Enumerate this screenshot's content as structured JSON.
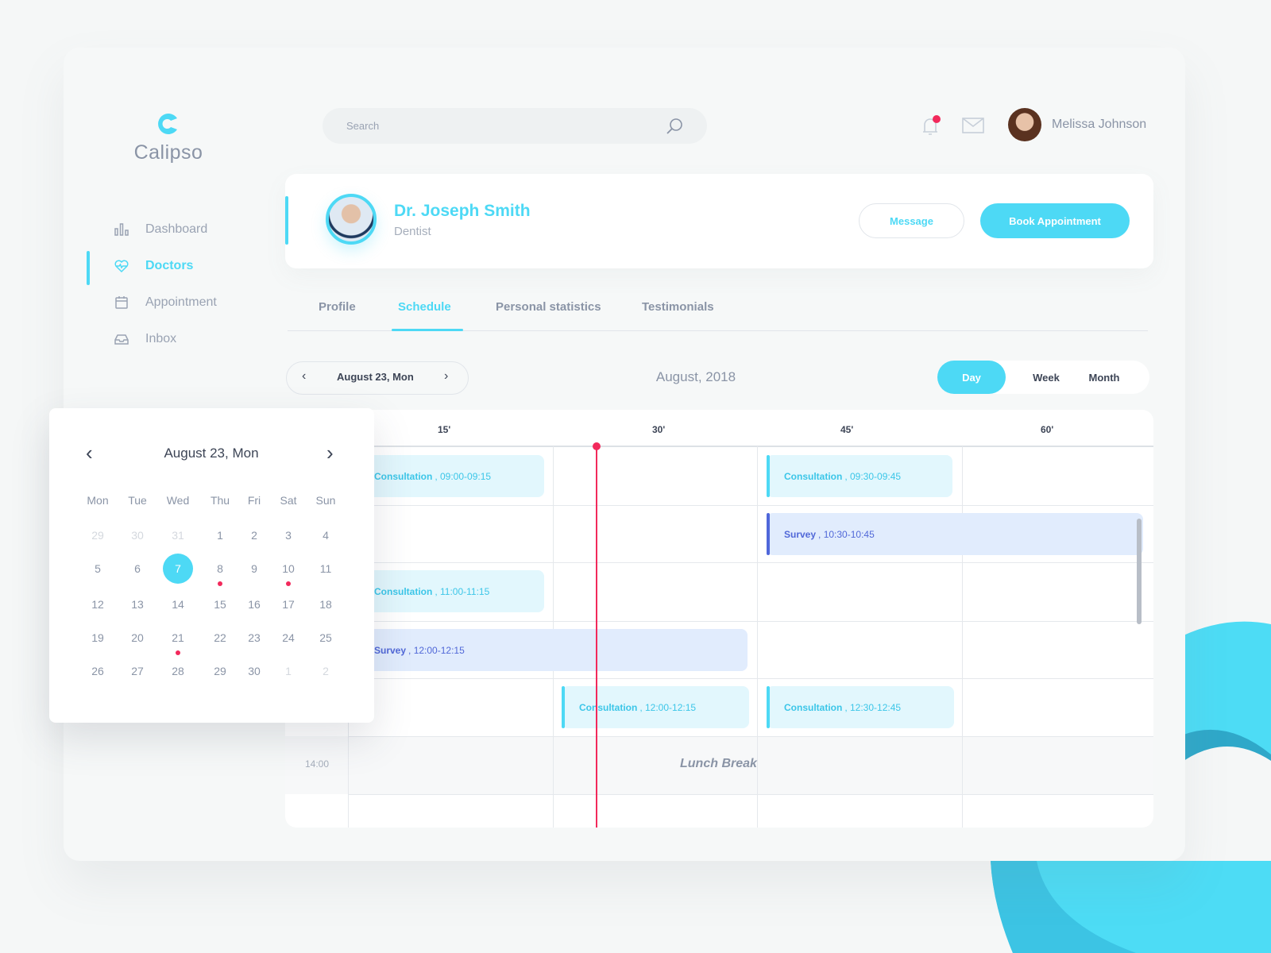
{
  "brand": {
    "name": "Calipso",
    "accent": "#4dd9f5"
  },
  "sidebar": {
    "items": [
      {
        "label": "Dashboard",
        "icon": "bar-chart-icon"
      },
      {
        "label": "Doctors",
        "icon": "heart-pulse-icon",
        "active": true
      },
      {
        "label": "Appointment",
        "icon": "calendar-icon"
      },
      {
        "label": "Inbox",
        "icon": "inbox-icon"
      }
    ]
  },
  "search": {
    "placeholder": "Search",
    "value": ""
  },
  "header": {
    "user_name": "Melissa Johnson",
    "notification_badge": true
  },
  "doctor": {
    "name": "Dr. Joseph Smith",
    "specialty": "Dentist",
    "message_label": "Message",
    "book_label": "Book Appointment"
  },
  "tabs": [
    {
      "label": "Profile"
    },
    {
      "label": "Schedule",
      "active": true
    },
    {
      "label": "Personal statistics"
    },
    {
      "label": "Testimonials"
    }
  ],
  "schedule": {
    "date_label": "August 23, Mon",
    "month_label": "August, 2018",
    "views": [
      "Day",
      "Week",
      "Month"
    ],
    "active_view": "Day",
    "column_headers": [
      "15'",
      "30'",
      "45'",
      "60'"
    ],
    "time_labels": [
      "14:00"
    ],
    "lunch_label": "Lunch Break",
    "events": [
      {
        "type": "Consultation",
        "time": "09:00-09:15"
      },
      {
        "type": "Consultation",
        "time": "09:30-09:45"
      },
      {
        "type": "Survey",
        "time": "10:30-10:45"
      },
      {
        "type": "Consultation",
        "time": "11:00-11:15"
      },
      {
        "type": "Survey",
        "time": "12:00-12:15"
      },
      {
        "type": "Consultation",
        "time": "12:00-12:15"
      },
      {
        "type": "Consultation",
        "time": "12:30-12:45"
      }
    ]
  },
  "mini_calendar": {
    "title": "August 23, Mon",
    "weekdays": [
      "Mon",
      "Tue",
      "Wed",
      "Thu",
      "Fri",
      "Sat",
      "Sun"
    ],
    "weeks": [
      [
        {
          "d": "29",
          "muted": true
        },
        {
          "d": "30",
          "muted": true
        },
        {
          "d": "31",
          "muted": true
        },
        {
          "d": "1"
        },
        {
          "d": "2"
        },
        {
          "d": "3"
        },
        {
          "d": "4"
        }
      ],
      [
        {
          "d": "5"
        },
        {
          "d": "6"
        },
        {
          "d": "7",
          "selected": true
        },
        {
          "d": "8",
          "dot": true
        },
        {
          "d": "9"
        },
        {
          "d": "10",
          "dot": true
        },
        {
          "d": "11"
        }
      ],
      [
        {
          "d": "12"
        },
        {
          "d": "13"
        },
        {
          "d": "14"
        },
        {
          "d": "15"
        },
        {
          "d": "16"
        },
        {
          "d": "17"
        },
        {
          "d": "18"
        }
      ],
      [
        {
          "d": "19"
        },
        {
          "d": "20"
        },
        {
          "d": "21",
          "dot": true
        },
        {
          "d": "22"
        },
        {
          "d": "23"
        },
        {
          "d": "24"
        },
        {
          "d": "25"
        }
      ],
      [
        {
          "d": "26"
        },
        {
          "d": "27"
        },
        {
          "d": "28"
        },
        {
          "d": "29"
        },
        {
          "d": "30"
        },
        {
          "d": "1",
          "muted": true
        },
        {
          "d": "2",
          "muted": true
        }
      ]
    ]
  }
}
